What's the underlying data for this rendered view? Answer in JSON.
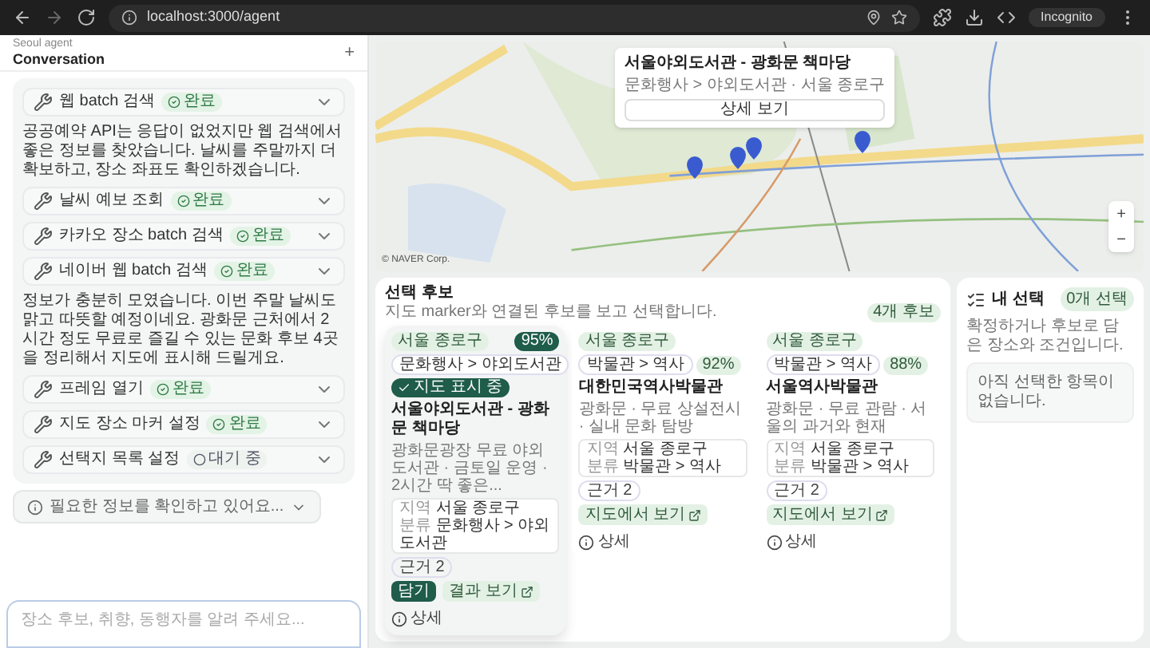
{
  "browser": {
    "url": "localhost:3000/agent",
    "profile": "Incognito"
  },
  "sidebar": {
    "subtitle": "Seoul agent",
    "title": "Conversation",
    "new_button": "+"
  },
  "chat": [
    {
      "kind": "tool",
      "label": "웹 batch 검색",
      "status": "완료",
      "pending": false
    },
    {
      "kind": "text",
      "text": "공공예약 API는 응답이 없었지만 웹 검색에서 좋은 정보를 찾았습니다. 날씨를 주말까지 더 확보하고, 장소 좌표도 확인하겠습니다."
    },
    {
      "kind": "tool",
      "label": "날씨 예보 조회",
      "status": "완료",
      "pending": false
    },
    {
      "kind": "tool",
      "label": "카카오 장소 batch 검색",
      "status": "완료",
      "pending": false
    },
    {
      "kind": "tool",
      "label": "네이버 웹 batch 검색",
      "status": "완료",
      "pending": false
    },
    {
      "kind": "text",
      "text": "정보가 충분히 모였습니다. 이번 주말 날씨도 맑고 따뜻할 예정이네요. 광화문 근처에서 2시간 정도 무료로 즐길 수 있는 문화 후보 4곳을 정리해서 지도에 표시해 드릴게요."
    },
    {
      "kind": "tool",
      "label": "프레임 열기",
      "status": "완료",
      "pending": false
    },
    {
      "kind": "tool",
      "label": "지도 장소 마커 설정",
      "status": "완료",
      "pending": false
    },
    {
      "kind": "tool",
      "label": "선택지 목록 설정",
      "status": "대기 중",
      "pending": true
    }
  ],
  "thinking": {
    "text": "필요한 정보를 확인하고 있어요...",
    "expanded": false
  },
  "composer": {
    "placeholder": "장소 후보, 취향, 동행자를 알려 주세요..."
  },
  "map": {
    "popup": {
      "title": "서울야외도서관 - 광화문 책마당",
      "subtitle": "문화행사 > 야외도서관 · 서울 종로구",
      "button": "상세 보기"
    },
    "zoom_in": "+",
    "zoom_out": "−",
    "attribution": "© NAVER Corp."
  },
  "candidates": {
    "title": "선택 후보",
    "subtitle": "지도 marker와 연결된 후보를 보고 선택합니다.",
    "count": "4개 후보",
    "items": [
      {
        "selected": true,
        "region": "서울 종로구",
        "score": "95%",
        "category": "문화행사 > 야외도서관",
        "showing": "지도 표시 중",
        "name": "서울야외도서관 - 광화문 책마당",
        "description": "광화문광장 무료 야외도서관 · 금토일 운영 · 2시간 딱 좋은...",
        "details": [
          {
            "label": "지역",
            "value": "서울 종로구"
          },
          {
            "label": "분류",
            "value": "문화행사 > 야외도서관"
          }
        ],
        "evidence": "근거 2",
        "actions": [
          {
            "label": "담기",
            "kind": "primary"
          },
          {
            "label": "결과 보기",
            "kind": "external"
          },
          {
            "label": "상세",
            "kind": "info"
          }
        ]
      },
      {
        "selected": false,
        "region": "서울 종로구",
        "category": "박물관 > 역사",
        "score": "92%",
        "name": "대한민국역사박물관",
        "description": "광화문 · 무료 상설전시 · 실내 문화 탐방",
        "details": [
          {
            "label": "지역",
            "value": "서울 종로구"
          },
          {
            "label": "분류",
            "value": "박물관 > 역사"
          }
        ],
        "evidence": "근거 2",
        "actions": [
          {
            "label": "지도에서 보기",
            "kind": "external"
          },
          {
            "label": "상세",
            "kind": "info"
          }
        ]
      },
      {
        "selected": false,
        "region": "서울 종로구",
        "category": "박물관 > 역사",
        "score": "88%",
        "name": "서울역사박물관",
        "description": "광화문 · 무료 관람 · 서울의 과거와 현재",
        "details": [
          {
            "label": "지역",
            "value": "서울 종로구"
          },
          {
            "label": "분류",
            "value": "박물관 > 역사"
          }
        ],
        "evidence": "근거 2",
        "actions": [
          {
            "label": "지도에서 보기",
            "kind": "external"
          },
          {
            "label": "상세",
            "kind": "info"
          }
        ]
      }
    ]
  },
  "my_selection": {
    "title": "내 선택",
    "count": "0개 선택",
    "subtitle": "확정하거나 후보로 담은 장소와 조건입니다.",
    "empty": "아직 선택한 항목이 없습니다."
  }
}
